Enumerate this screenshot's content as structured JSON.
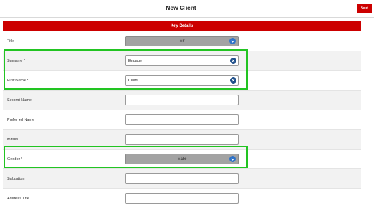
{
  "header": {
    "title": "New Client",
    "next_label": "Next"
  },
  "section": {
    "title": "Key Details"
  },
  "fields": {
    "title": {
      "label": "Title",
      "value": "Mr"
    },
    "surname": {
      "label": "Surname *",
      "value": "Engage"
    },
    "first_name": {
      "label": "First Name *",
      "value": "Client"
    },
    "second_name": {
      "label": "Second Name",
      "value": ""
    },
    "preferred_name": {
      "label": "Preferred Name",
      "value": ""
    },
    "initials": {
      "label": "Initials",
      "value": ""
    },
    "gender": {
      "label": "Gender *",
      "value": "Male"
    },
    "salutation": {
      "label": "Salutation",
      "value": ""
    },
    "address_title": {
      "label": "Address Title",
      "value": ""
    }
  },
  "colors": {
    "accent": "#cc0000",
    "highlight": "#22c422",
    "icon_blue": "#2f73c9",
    "select_bg": "#a3a3a3"
  },
  "icons": {
    "dropdown": "chevron-down-icon",
    "clear": "clear-icon"
  }
}
